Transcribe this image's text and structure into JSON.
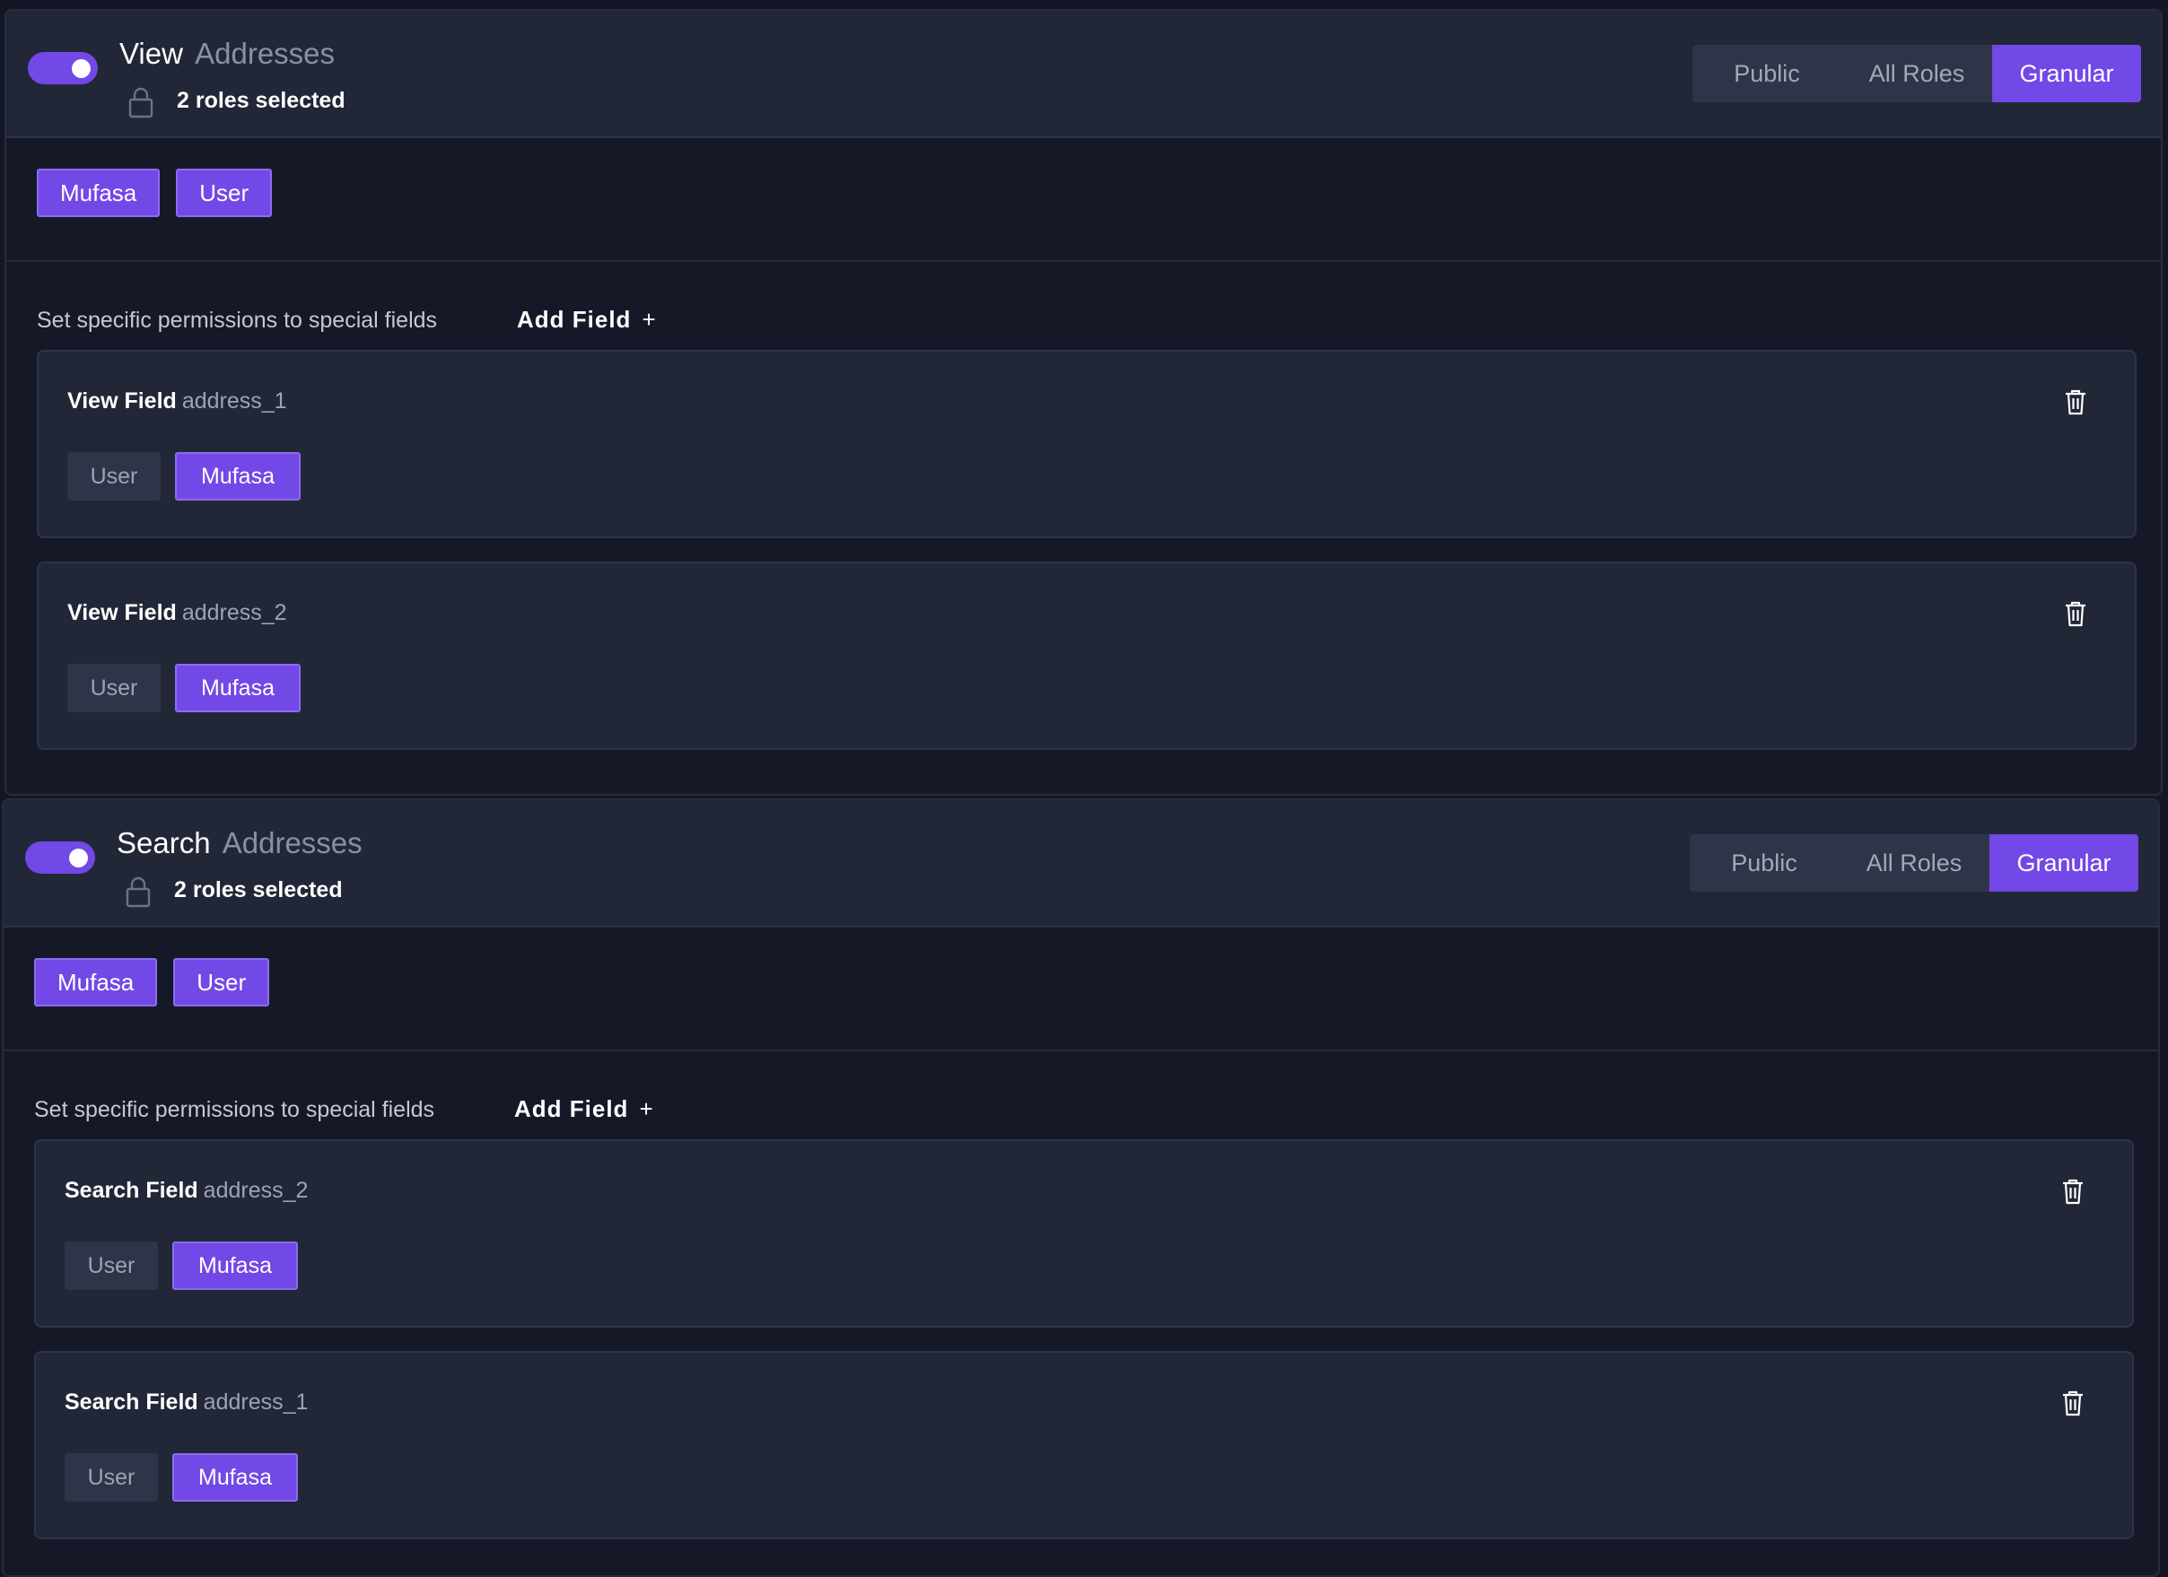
{
  "colors": {
    "accent": "#7248e6",
    "panel_header": "#222738",
    "background": "#131624"
  },
  "permissions": [
    {
      "verb": "View",
      "noun": "Addresses",
      "toggle_on": true,
      "roles_selected": "2 roles selected",
      "scope_options": [
        "Public",
        "All Roles",
        "Granular"
      ],
      "scope_selected": "Granular",
      "role_tags": [
        "Mufasa",
        "User"
      ],
      "special_label": "Set specific permissions to special fields",
      "add_field_label": "Add Field",
      "fields": [
        {
          "verb": "View Field",
          "name": "address_1",
          "roles": [
            "User",
            "Mufasa"
          ],
          "selected": [
            "Mufasa"
          ]
        },
        {
          "verb": "View Field",
          "name": "address_2",
          "roles": [
            "User",
            "Mufasa"
          ],
          "selected": [
            "Mufasa"
          ]
        }
      ]
    },
    {
      "verb": "Search",
      "noun": "Addresses",
      "toggle_on": true,
      "roles_selected": "2 roles selected",
      "scope_options": [
        "Public",
        "All Roles",
        "Granular"
      ],
      "scope_selected": "Granular",
      "role_tags": [
        "Mufasa",
        "User"
      ],
      "special_label": "Set specific permissions to special fields",
      "add_field_label": "Add Field",
      "fields": [
        {
          "verb": "Search Field",
          "name": "address_2",
          "roles": [
            "User",
            "Mufasa"
          ],
          "selected": [
            "Mufasa"
          ]
        },
        {
          "verb": "Search Field",
          "name": "address_1",
          "roles": [
            "User",
            "Mufasa"
          ],
          "selected": [
            "Mufasa"
          ]
        }
      ]
    }
  ],
  "icons": {
    "lock": "lock-icon",
    "trash": "trash-icon",
    "plus": "plus-icon"
  }
}
